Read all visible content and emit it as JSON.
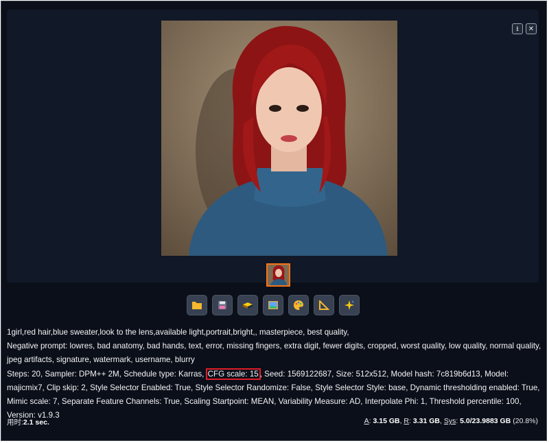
{
  "gallery": {
    "download_icon": "download-icon",
    "close_icon": "close-icon",
    "image_alt": "Generated portrait: red-haired girl in blue sweater"
  },
  "toolbar": {
    "buttons": [
      {
        "icon": "folder-icon"
      },
      {
        "icon": "save-icon"
      },
      {
        "icon": "zip-icon"
      },
      {
        "icon": "image-icon"
      },
      {
        "icon": "palette-icon"
      },
      {
        "icon": "ruler-icon"
      },
      {
        "icon": "sparkle-icon"
      }
    ]
  },
  "info": {
    "prompt": "1girl,red hair,blue sweater,look to the lens,available light,portrait,bright,, masterpiece, best quality,",
    "negative_prompt": "Negative prompt: lowres, bad anatomy, bad hands, text, error, missing fingers, extra digit, fewer digits, cropped, worst quality, low quality, normal quality, jpeg artifacts, signature, watermark, username, blurry",
    "params_before": "Steps: 20, Sampler: DPM++ 2M, Schedule type: Karras, ",
    "params_cfg": "CFG scale: 15",
    "params_after": ", Seed: 1569122687, Size: 512x512, Model hash: 7c819b6d13, Model: majicmix7, Clip skip: 2, Style Selector Enabled: True, Style Selector Randomize: False, Style Selector Style: base, Dynamic thresholding enabled: True, Mimic scale: 7, Separate Feature Channels: True, Scaling Startpoint: MEAN, Variability Measure: AD, Interpolate Phi: 1, Threshold percentile: 100, Version: v1.9.3"
  },
  "footer": {
    "time_label": "用时:",
    "time_value": "2.1 sec.",
    "a_label": "A",
    "a_value": "3.15 GB",
    "r_label": "R",
    "r_value": "3.31 GB",
    "sys_label": "Sys",
    "sys_value": "5.0/23.9883 GB",
    "sys_pct": "(20.8%)"
  },
  "colors": {
    "background": "#0b0f19",
    "panel": "#111827",
    "highlight": "#e11d2a",
    "thumb_border": "#f97316"
  }
}
